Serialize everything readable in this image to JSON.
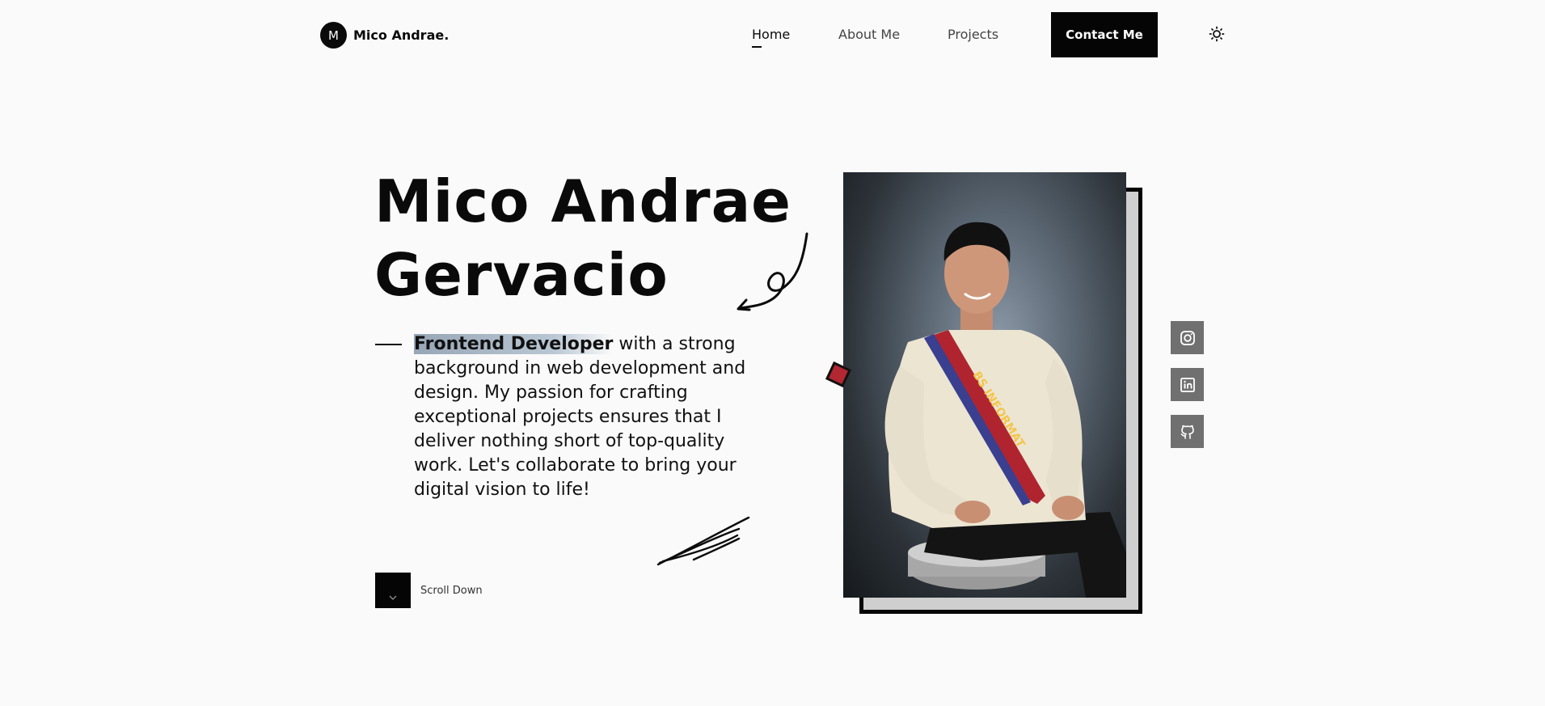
{
  "nav": {
    "logo_letter": "M",
    "logo_text": "Mico Andrae.",
    "links": [
      {
        "label": "Home",
        "active": true
      },
      {
        "label": "About Me",
        "active": false
      },
      {
        "label": "Projects",
        "active": false
      }
    ],
    "contact_label": "Contact Me",
    "theme_icon": "sun-icon"
  },
  "hero": {
    "name_line1": "Mico Andrae",
    "name_line2": "Gervacio",
    "role_highlight": "Frontend Developer",
    "description": " with a strong background in web development and design. My passion for crafting exceptional projects ensures that I deliver nothing short of top-quality work. Let's collaborate to bring your digital vision to life!",
    "scroll_label": "Scroll Down",
    "scroll_icon": "chevron-down-icon"
  },
  "photo": {
    "alt": "Portrait of Mico Andrae Gervacio",
    "sash_text": "BS INFORMAT"
  },
  "socials": [
    {
      "name": "instagram",
      "icon": "instagram-icon"
    },
    {
      "name": "linkedin",
      "icon": "linkedin-icon"
    },
    {
      "name": "github",
      "icon": "github-icon"
    }
  ],
  "colors": {
    "background": "#fafafa",
    "primary": "#050505",
    "social_bg": "#707070",
    "highlight": "#a9b7c6",
    "accent_red": "#b12732"
  }
}
